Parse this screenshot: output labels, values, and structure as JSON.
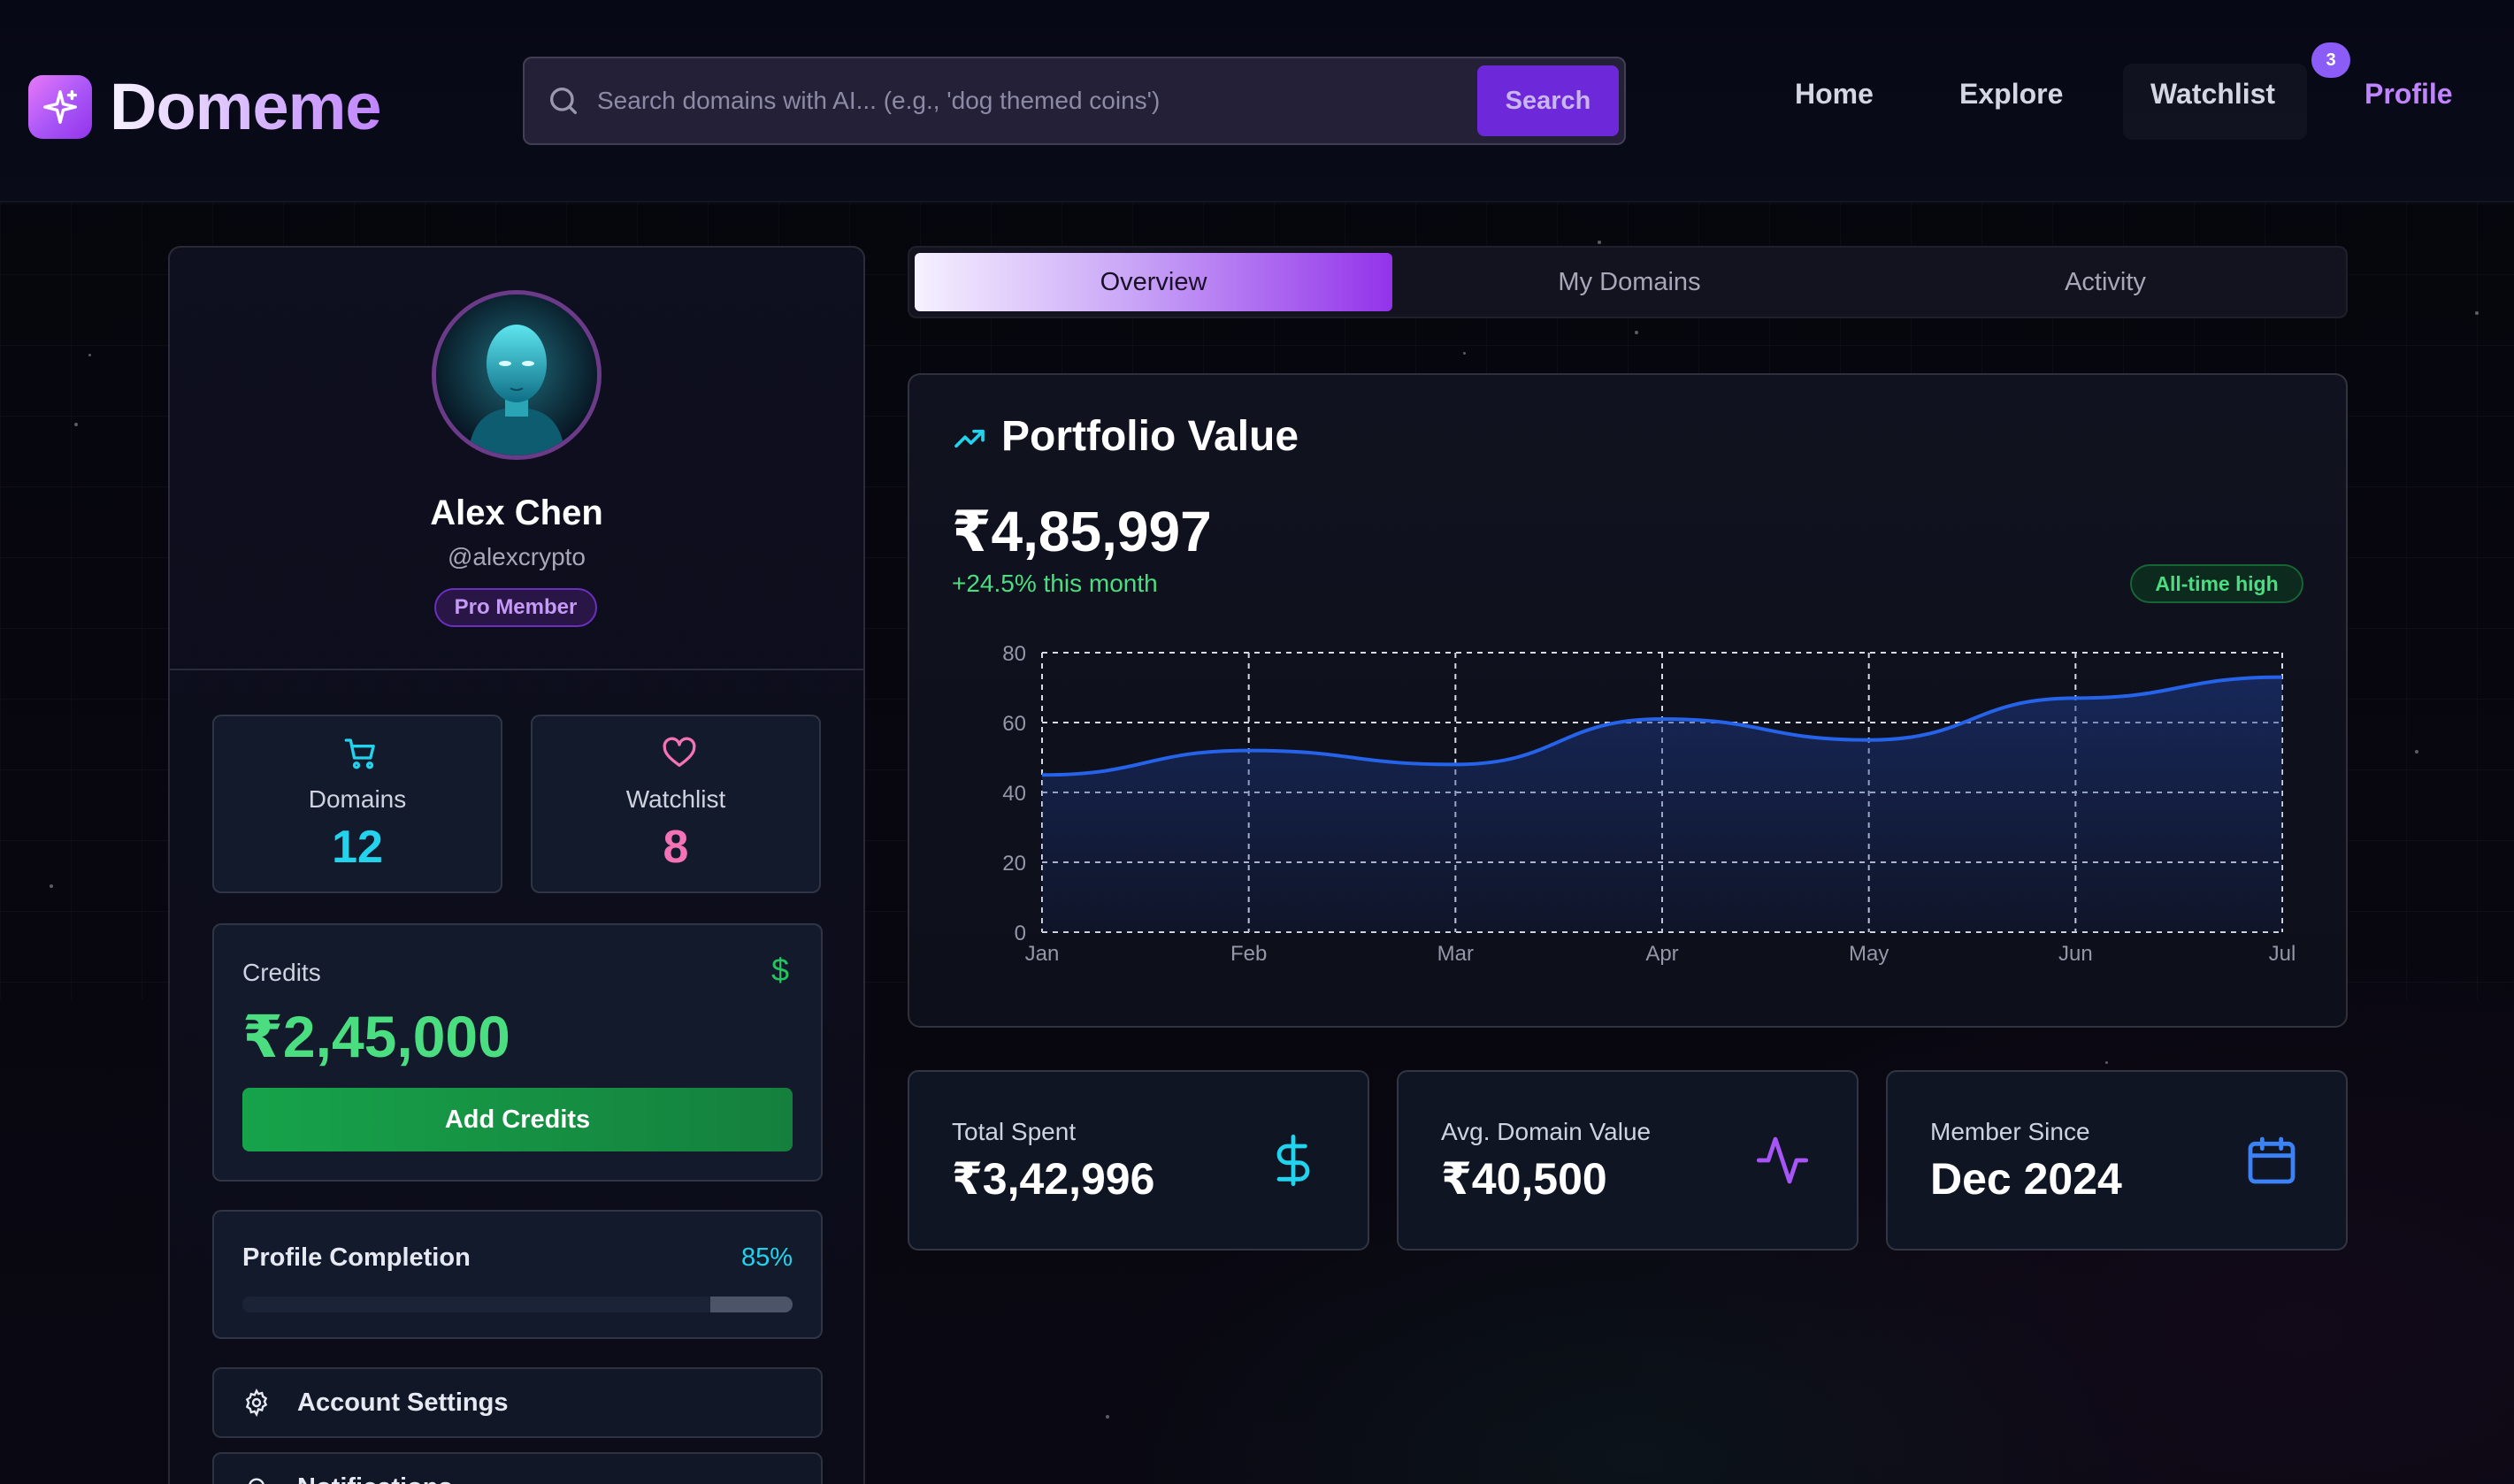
{
  "brand": {
    "name": "Domeme",
    "logo_icon": "sparkle-icon"
  },
  "search": {
    "placeholder": "Search domains with AI... (e.g., 'dog themed coins')",
    "button_label": "Search"
  },
  "nav": {
    "home": "Home",
    "explore": "Explore",
    "watchlist": "Watchlist",
    "watchlist_badge": "3",
    "profile": "Profile"
  },
  "profile": {
    "name": "Alex Chen",
    "handle": "@alexcrypto",
    "membership": "Pro Member"
  },
  "stats": {
    "domains": {
      "label": "Domains",
      "value": "12",
      "icon": "cart-icon",
      "color": "#22d3ee"
    },
    "watchlist": {
      "label": "Watchlist",
      "value": "8",
      "icon": "heart-icon",
      "color": "#f472b6"
    }
  },
  "credits": {
    "label": "Credits",
    "value": "₹2,45,000",
    "button_label": "Add Credits"
  },
  "completion": {
    "label": "Profile Completion",
    "percent_label": "85%",
    "percent": 0.85
  },
  "menu": {
    "account_settings": "Account Settings",
    "notifications": "Notifications"
  },
  "tabs": [
    "Overview",
    "My Domains",
    "Activity"
  ],
  "portfolio": {
    "title": "Portfolio Value",
    "value": "₹4,85,997",
    "change": "+24.5% this month",
    "badge": "All-time high"
  },
  "chart_data": {
    "type": "area",
    "categories": [
      "Jan",
      "Feb",
      "Mar",
      "Apr",
      "May",
      "Jun",
      "Jul"
    ],
    "values": [
      45,
      52,
      48,
      61,
      55,
      67,
      73
    ],
    "ylim": [
      0,
      80
    ],
    "yticks": [
      0,
      20,
      40,
      60,
      80
    ],
    "grid": true,
    "line_color": "#2563eb"
  },
  "summary": {
    "total_spent": {
      "label": "Total Spent",
      "value": "₹3,42,996",
      "icon": "dollar-icon"
    },
    "avg_value": {
      "label": "Avg. Domain Value",
      "value": "₹40,500",
      "icon": "activity-icon"
    },
    "member_since": {
      "label": "Member Since",
      "value": "Dec 2024",
      "icon": "calendar-icon"
    }
  }
}
